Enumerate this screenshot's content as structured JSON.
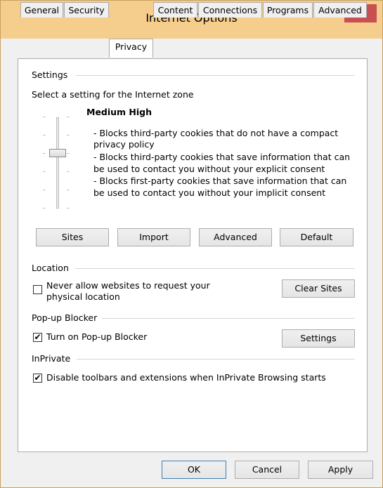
{
  "window": {
    "title": "Internet Options",
    "help_label": "?",
    "close_label": "✕"
  },
  "tabs": [
    "General",
    "Security",
    "Privacy",
    "Content",
    "Connections",
    "Programs",
    "Advanced"
  ],
  "settings": {
    "group_label": "Settings",
    "zone_text": "Select a setting for the Internet zone",
    "level_title": "Medium High",
    "description_lines": [
      "- Blocks third-party cookies that do not have a compact",
      "privacy policy",
      "- Blocks third-party cookies that save information that can",
      "be used to contact you without your explicit consent",
      "- Blocks first-party cookies that save information that can",
      "be used to contact you without your implicit consent"
    ],
    "buttons": {
      "sites": "Sites",
      "import": "Import",
      "advanced": "Advanced",
      "default": "Default"
    }
  },
  "location": {
    "group_label": "Location",
    "checkbox_line1": "Never allow websites to request your",
    "checkbox_line2": "physical location",
    "checked": false,
    "clear_sites": "Clear Sites"
  },
  "popup": {
    "group_label": "Pop-up Blocker",
    "checkbox_label": "Turn on Pop-up Blocker",
    "checked": true,
    "settings_button": "Settings"
  },
  "inprivate": {
    "group_label": "InPrivate",
    "checkbox_label": "Disable toolbars and extensions when InPrivate Browsing starts",
    "checked": true
  },
  "footer": {
    "ok": "OK",
    "cancel": "Cancel",
    "apply": "Apply"
  },
  "colors": {
    "titlebar": "#f5cd8c",
    "close": "#c75050",
    "panel": "#ffffff",
    "face": "#f0f0f0"
  }
}
